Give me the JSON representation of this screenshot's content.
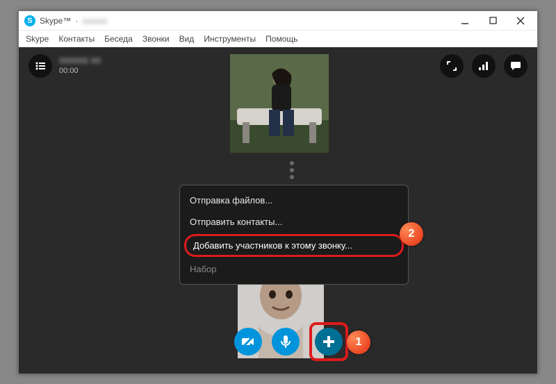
{
  "window": {
    "app_name": "Skype™",
    "separator": " · ",
    "user_blurred": "xxxxxx"
  },
  "menubar": [
    "Skype",
    "Контакты",
    "Беседа",
    "Звонки",
    "Вид",
    "Инструменты",
    "Помощь"
  ],
  "call": {
    "contact_blurred": "xxxxxx xx",
    "timer": "00:00"
  },
  "popup": {
    "items": [
      {
        "label": "Отправка файлов...",
        "highlight": false
      },
      {
        "label": "Отправить контакты...",
        "highlight": false
      },
      {
        "label": "Добавить участников к этому звонку...",
        "highlight": true
      },
      {
        "label": "Набор",
        "highlight": false,
        "dim": true
      }
    ]
  },
  "badges": {
    "one": "1",
    "two": "2"
  },
  "icons": {
    "list": "list-icon",
    "fullscreen": "fullscreen-icon",
    "quality": "signal-icon",
    "chat": "chat-icon",
    "camera_off": "camera-off-icon",
    "mic": "mic-icon",
    "add": "plus-icon"
  }
}
